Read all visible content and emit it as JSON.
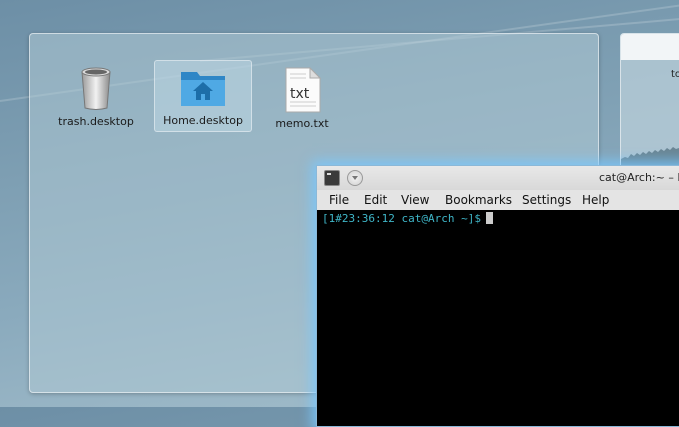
{
  "desktop": {
    "icons": [
      {
        "label": "trash.desktop",
        "icon": "trash-icon"
      },
      {
        "label": "Home.desktop",
        "icon": "home-folder-icon",
        "selected": true
      },
      {
        "label": "memo.txt",
        "icon": "text-file-icon",
        "badge": "txt"
      }
    ]
  },
  "right_widget": {
    "text": "to"
  },
  "terminal": {
    "title": "cat@Arch:~ – Ko",
    "menu": [
      "File",
      "Edit",
      "View",
      "Bookmarks",
      "Settings",
      "Help"
    ],
    "prompt": "[1#23:36:12 cat@Arch ~]$",
    "prompt_color": "#3fb6c8"
  },
  "colors": {
    "glow": "#78c8ff",
    "folder_blue": "#3f9fd9"
  }
}
